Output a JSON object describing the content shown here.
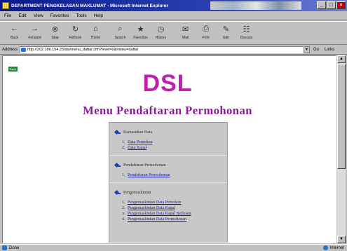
{
  "window": {
    "title": "DEPARTMENT PENGKELASAN MAKLUMAT - Microsoft Internet Explorer",
    "buttons": {
      "minimize": "_",
      "maximize": "□",
      "close": "×"
    }
  },
  "menubar": {
    "items": [
      "File",
      "Edit",
      "View",
      "Favorites",
      "Tools",
      "Help"
    ]
  },
  "toolbar": {
    "buttons": [
      {
        "label": "Back",
        "icon": "back-arrow-icon",
        "glyph": "←"
      },
      {
        "label": "Forward",
        "icon": "forward-arrow-icon",
        "glyph": "→"
      },
      {
        "label": "Stop",
        "icon": "stop-icon",
        "glyph": "⊗"
      },
      {
        "label": "Refresh",
        "icon": "refresh-icon",
        "glyph": "↻"
      },
      {
        "label": "Home",
        "icon": "home-icon",
        "glyph": "⌂"
      },
      {
        "label": "Search",
        "icon": "search-icon",
        "glyph": "⌕"
      },
      {
        "label": "Favorites",
        "icon": "favorites-icon",
        "glyph": "★"
      },
      {
        "label": "History",
        "icon": "history-icon",
        "glyph": "◷"
      },
      {
        "label": "Mail",
        "icon": "mail-icon",
        "glyph": "✉"
      },
      {
        "label": "Print",
        "icon": "print-icon",
        "glyph": "⎙"
      },
      {
        "label": "Edit",
        "icon": "edit-icon",
        "glyph": "✎"
      },
      {
        "label": "Discuss",
        "icon": "discuss-icon",
        "glyph": "☷"
      }
    ]
  },
  "addressbar": {
    "label": "Address",
    "url": "http://202.186.154.25/dsl/menu_daftar.cfm?level=0&menu=daftar",
    "go_label": "Go",
    "links_label": "Links"
  },
  "page": {
    "back_badge": "Back",
    "heading": "DSL",
    "subheading": "Menu Pendaftaran Permohonan",
    "sections": [
      {
        "title": "Kemasukan Data",
        "items": [
          {
            "num": "1.",
            "label": "Data Pemohon"
          },
          {
            "num": "2.",
            "label": "Data Kapal"
          }
        ]
      },
      {
        "title": "Pendaftaran Permohonan",
        "items": [
          {
            "num": "1.",
            "label": "Pendaftaran Permohonan"
          }
        ]
      },
      {
        "title": "Pengemaskinian",
        "items": [
          {
            "num": "1.",
            "label": "Pengemaskinian Data Pemohon"
          },
          {
            "num": "2.",
            "label": "Pengemaskinian Data Kapal"
          },
          {
            "num": "3.",
            "label": "Pengemaskinian Data Kapal Berlesen"
          },
          {
            "num": "4.",
            "label": "Pengemaskinian Data Permohonan"
          }
        ]
      }
    ]
  },
  "statusbar": {
    "text": "Done",
    "zone": "Internet"
  },
  "colors": {
    "heading": "#c41cb0",
    "subheading": "#8a1a98",
    "link": "#1a1aa0",
    "titlebar": "#0a1a8c"
  }
}
